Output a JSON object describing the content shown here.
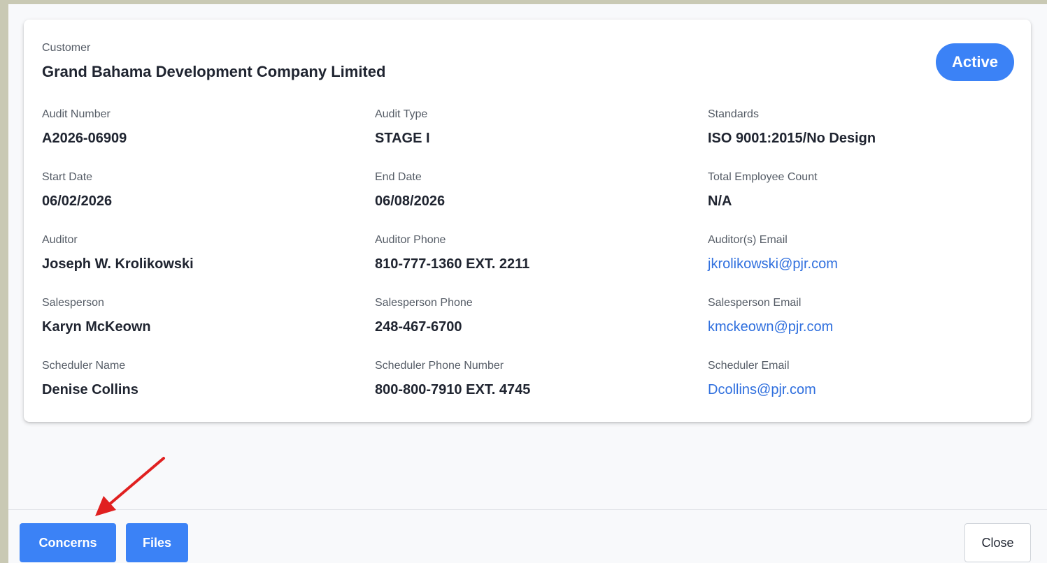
{
  "header": {
    "customer_label": "Customer",
    "customer_name": "Grand Bahama Development Company Limited",
    "status": "Active"
  },
  "fields": [
    {
      "label": "Audit Number",
      "value": "A2026-06909",
      "is_link": false
    },
    {
      "label": "Audit Type",
      "value": "STAGE I",
      "is_link": false
    },
    {
      "label": "Standards",
      "value": "ISO 9001:2015/No Design",
      "is_link": false
    },
    {
      "label": "Start Date",
      "value": "06/02/2026",
      "is_link": false
    },
    {
      "label": "End Date",
      "value": "06/08/2026",
      "is_link": false
    },
    {
      "label": "Total Employee Count",
      "value": "N/A",
      "is_link": false
    },
    {
      "label": "Auditor",
      "value": "Joseph W. Krolikowski",
      "is_link": false
    },
    {
      "label": "Auditor Phone",
      "value": "810-777-1360 EXT. 2211",
      "is_link": false
    },
    {
      "label": "Auditor(s) Email",
      "value": "jkrolikowski@pjr.com",
      "is_link": true
    },
    {
      "label": "Salesperson",
      "value": "Karyn McKeown",
      "is_link": false
    },
    {
      "label": "Salesperson Phone",
      "value": "248-467-6700",
      "is_link": false
    },
    {
      "label": "Salesperson Email",
      "value": "kmckeown@pjr.com",
      "is_link": true
    },
    {
      "label": "Scheduler Name",
      "value": "Denise Collins",
      "is_link": false
    },
    {
      "label": "Scheduler Phone Number",
      "value": "800-800-7910 EXT. 4745",
      "is_link": false
    },
    {
      "label": "Scheduler Email",
      "value": "Dcollins@pjr.com",
      "is_link": true
    }
  ],
  "footer": {
    "concerns_label": "Concerns",
    "files_label": "Files",
    "close_label": "Close"
  },
  "colors": {
    "accent": "#3b82f6",
    "link": "#2f6fde",
    "annotation_arrow": "#e02020"
  }
}
